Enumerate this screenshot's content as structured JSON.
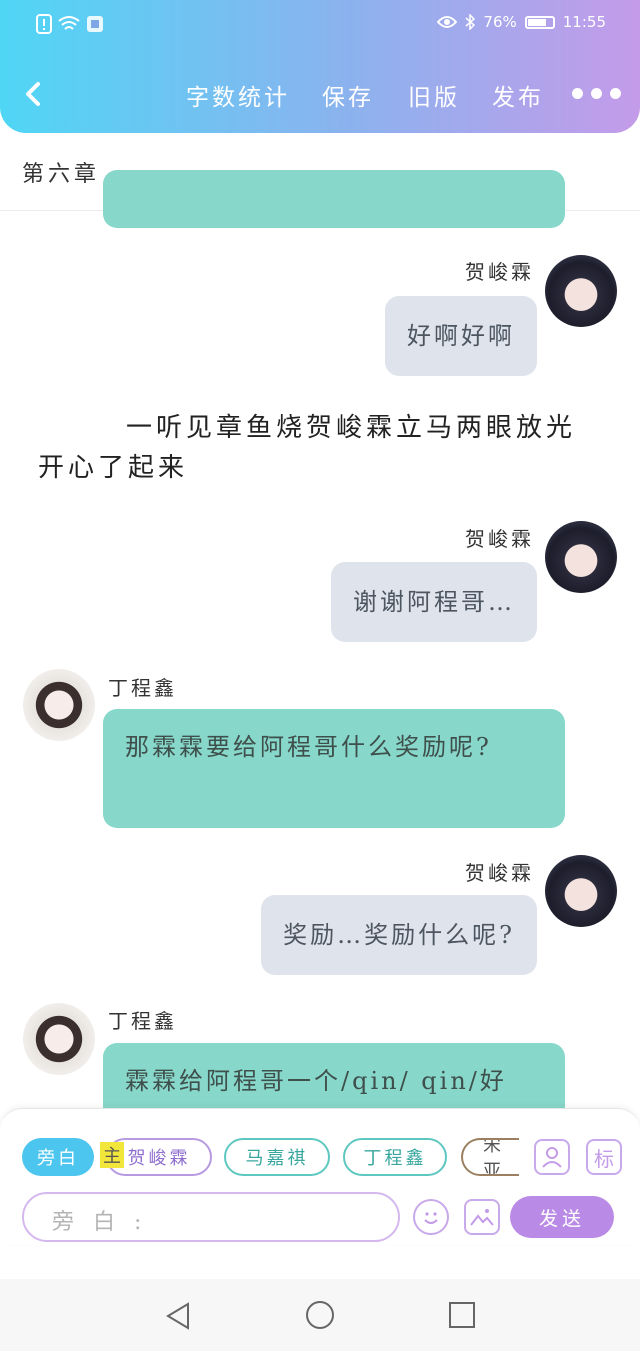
{
  "status_bar": {
    "battery": "76%",
    "time": "11:55"
  },
  "nav": {
    "back_icon": "chevron-left-icon",
    "word_count": "字数统计",
    "save": "保存",
    "old_version": "旧版",
    "publish": "发布",
    "more_icon": "more-dots-icon"
  },
  "chapter_title": "第六章",
  "messages": [
    {
      "speaker": "贺峻霖",
      "text": "好啊好啊"
    },
    {
      "narration": "一听见章鱼烧贺峻霖立马两眼放光开心了起来"
    },
    {
      "speaker": "贺峻霖",
      "text": "谢谢阿程哥…"
    },
    {
      "speaker": "丁程鑫",
      "text": "那霖霖要给阿程哥什么奖励呢?"
    },
    {
      "speaker": "贺峻霖",
      "text": "奖励…奖励什么呢?"
    },
    {
      "speaker": "丁程鑫",
      "text": "霖霖给阿程哥一个/qin/ qin/好"
    }
  ],
  "composer": {
    "role_chips": [
      "旁白",
      "贺峻霖",
      "马嘉祺",
      "丁程鑫",
      "宋亚"
    ],
    "main_tag": "主",
    "tag_button": "标",
    "placeholder": "旁 白 :",
    "send": "发送"
  },
  "colors": {
    "header_start": "#4fd6f5",
    "header_end": "#c49be9",
    "bubble_ding": "#87d8ca",
    "bubble_he": "#dfe4ec",
    "send": "#b98ae6"
  }
}
